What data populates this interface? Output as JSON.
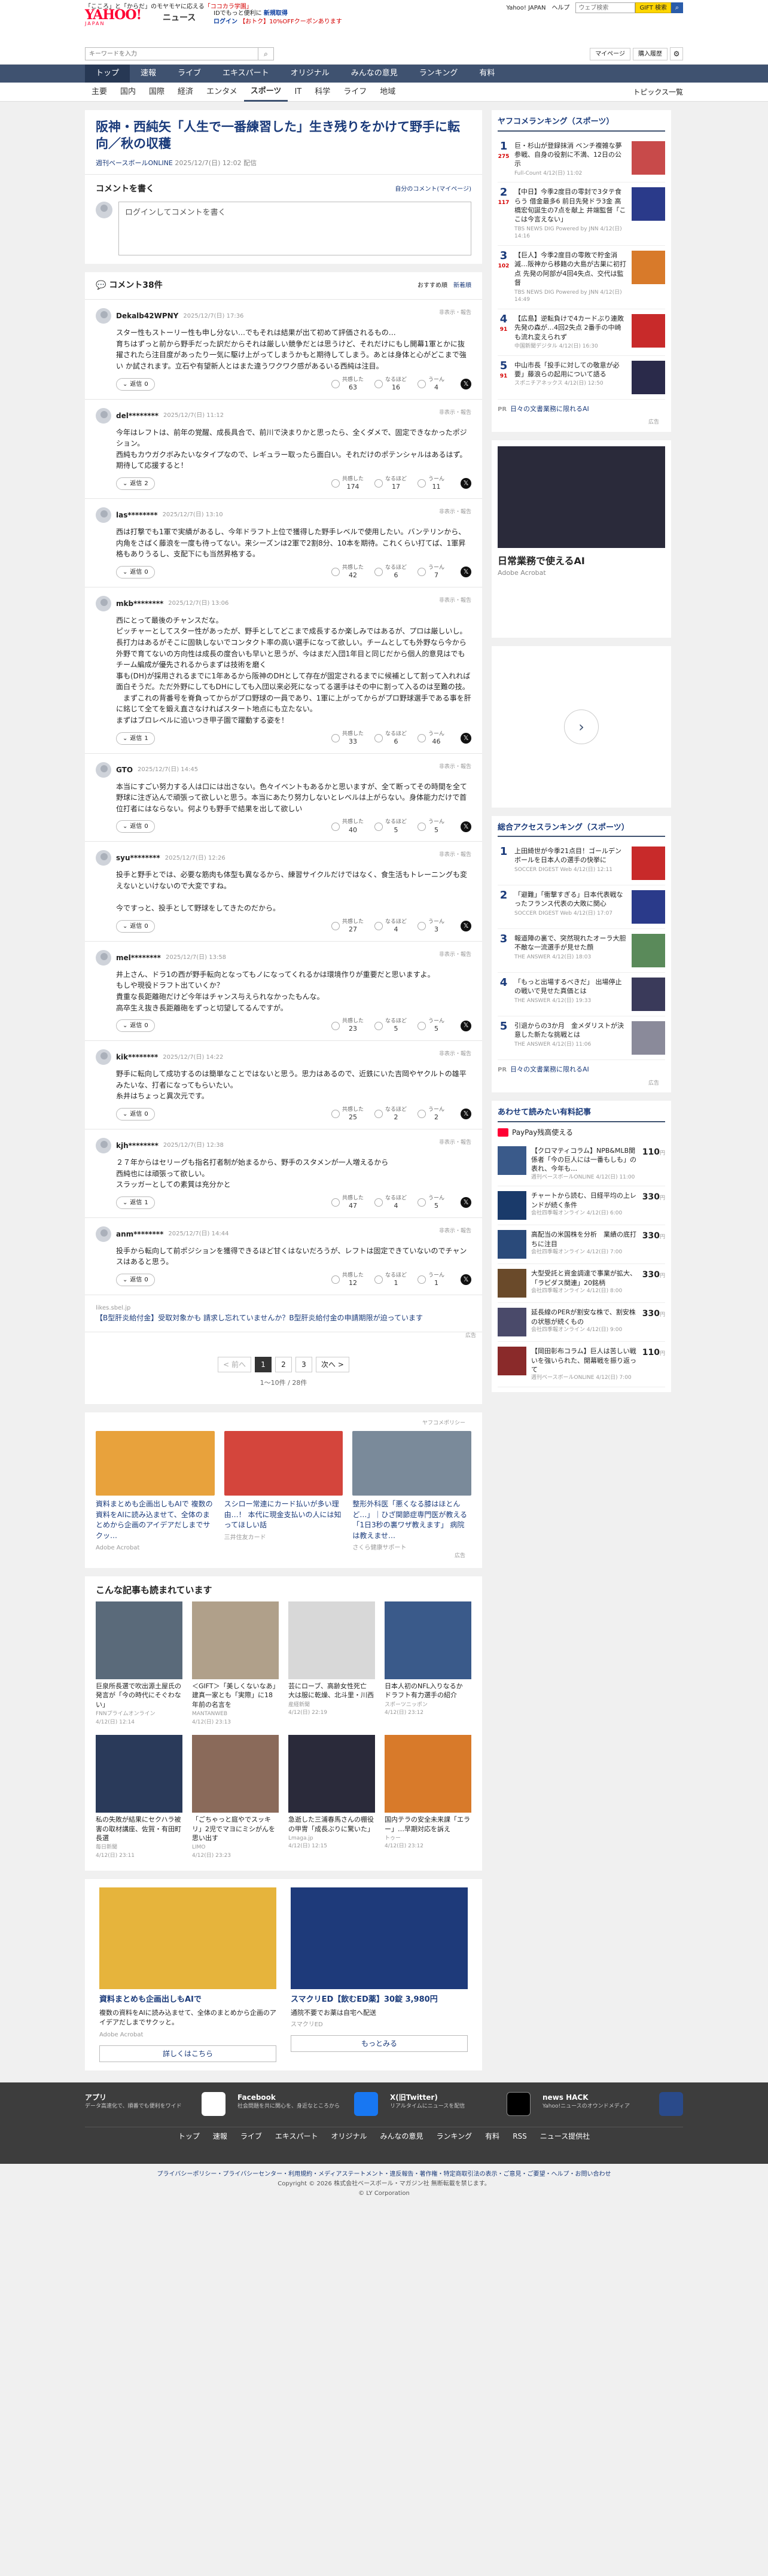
{
  "header": {
    "promo_plain": "「こころ」と「からだ」のモヤモヤに応える",
    "promo_em": "「ココカラ学園」",
    "logo": "YAHOO!",
    "logo_sub": "JAPAN",
    "service": "ニュース",
    "msg_line1": "IDでもっと便利に",
    "msg_line1_em": "新規取得",
    "msg_line2_a": "ログイン",
    "msg_line2_b": "【おトク】10%OFFクーポンあります",
    "top_links": [
      "Yahoo! JAPAN",
      "ヘルプ"
    ],
    "top_search_placeholder": "ウェブ検索",
    "top_gift": "GIFT 検索",
    "search_placeholder": "キーワードを入力",
    "links": [
      "マイページ",
      "購入履歴"
    ]
  },
  "nav": {
    "primary": [
      "トップ",
      "速報",
      "ライブ",
      "エキスパート",
      "オリジナル",
      "みんなの意見",
      "ランキング",
      "有料"
    ],
    "secondary": [
      "主要",
      "国内",
      "国際",
      "経済",
      "エンタメ",
      "スポーツ",
      "IT",
      "科学",
      "ライフ",
      "地域"
    ],
    "secondary_active": 5,
    "topics": "トピックス一覧"
  },
  "article": {
    "title": "阪神・西純矢「人生で一番練習した」生き残りをかけて野手に転向／秋の収穫",
    "source": "週刊ベースボールONLINE",
    "date": "2025/12/7(日) 12:02 配信"
  },
  "compose": {
    "heading": "コメントを書く",
    "policy": "自分のコメント(マイページ)",
    "placeholder": "ログインしてコメントを書く"
  },
  "comments_head": {
    "title": "コメント38件",
    "sort": [
      "おすすめ順",
      "新着順"
    ]
  },
  "comment_labels": {
    "report": "非表示・報告",
    "reply_prefix": "返信",
    "react": [
      "共感した",
      "なるほど",
      "うーん"
    ]
  },
  "comments": [
    {
      "user": "Dekalb42WPNY",
      "date": "2025/12/7(日) 17:36",
      "text": "スター性もストーリー性も申し分ない…でもそれは結果が出て初めて評価されるもの…\n育ちはずっと前から野手だった訳だからそれは厳しい競争だとは思うけど、それだけにもし開幕1軍とかに抜擢されたら注目度があったり一気に駆け上がってしまうかもと期待してしまう。あとは身体と心がどこまで強い か試されます。立石や有望新人とはまた違うワクワク感があるいる西純は注目。",
      "replies": "0",
      "r1": "63",
      "r2": "16",
      "r3": "4"
    },
    {
      "user": "del********",
      "date": "2025/12/7(日) 11:12",
      "text": "今年はレフトは、前年の覚醒、成長具合で、前川で決まりかと思ったら、全くダメで、固定できなかったポジション。\n西純もカウガクボみたいなタイプなので、レギュラー取ったら面白い。それだけのポテンシャルはあるはず。期待して応援すると！",
      "replies": "2",
      "r1": "174",
      "r2": "17",
      "r3": "11"
    },
    {
      "user": "las********",
      "date": "2025/12/7(日) 13:10",
      "text": "西は打撃でも1軍で実績があるし、今年ドラフト上位で獲得した野手レベルで使用したい。バンテリンから、内角をさばく藤浪を一度も待ってない。来シーズンは2軍で2割8分、10本を期待。これくらい打てば、1軍昇格もありうるし、支配下にも当然昇格する。",
      "replies": "0",
      "r1": "42",
      "r2": "6",
      "r3": "7"
    },
    {
      "user": "mkb********",
      "date": "2025/12/7(日) 13:06",
      "text": "西にとって最後のチャンスだな。\nピッチャーとしてスター性があったが、野手としてどこまで成長するか楽しみではあるが、プロは厳しいし。\n長打力はあるがそこに固執しないでコンタクト率の高い選手になって欲しい。チームとしても外野なら今から外野で育てないの方向性は成長の度合いも早いと思うが、今はまだ入団1年目と同じだから個人的意見はでもチーム編成が優先されるからまずは技術を磨く\n事も(DH)が採用されるまでに1年あるから阪神のDHとして存在が固定されるまでに候補として割って入れれば面白そうだ。ただ外野にしてもDHにしても入団以来必死になってる選手はその中に割って入るのは至難の技。\n　まずこれの背番号を脊負ってからがプロ野球の一員であり、1軍に上がってからがプロ野球選手である事を肝に銘じて全てを鍛え直さなければスタート地点にも立たない。\nまずはブロレベルに追いつき甲子園で躍動する姿を！",
      "replies": "1",
      "r1": "33",
      "r2": "6",
      "r3": "46"
    },
    {
      "user": "GTO",
      "date": "2025/12/7(日) 14:45",
      "text": "本当にすごい努力する人は口には出さない。色々イベントもあるかと思いますが、全て断ってその時間を全て野球に注ぎ込んで頑張って欲しいと思う。本当にあたり努力しないとレベルは上がらない。身体能力だけで首位打者にはならない。何よりも野手で結果を出して欲しい",
      "replies": "0",
      "r1": "40",
      "r2": "5",
      "r3": "5"
    },
    {
      "user": "syu********",
      "date": "2025/12/7(日) 12:26",
      "text": "投手と野手とでは、必要な筋肉も体型も異なるから、練習サイクルだけではなく、食生活もトレーニングも変えないといけないので大変ですね。\n\n今ですっと、投手として野球をしてきたのだから。",
      "replies": "0",
      "r1": "27",
      "r2": "4",
      "r3": "3"
    },
    {
      "user": "mel********",
      "date": "2025/12/7(日) 13:58",
      "text": "井上さん、ドラ1の西が野手転向となってもノになってくれるかは環境作りが重要だと思いますよ。\nもしや現役ドラフト出ていくか？\n貴重な長距離砲だけど今年はチャンス与えられなかったもんな。\n高卒生え抜き長距離砲をずっと切望してるんですが。",
      "replies": "0",
      "r1": "23",
      "r2": "5",
      "r3": "5"
    },
    {
      "user": "kik********",
      "date": "2025/12/7(日) 14:22",
      "text": "野手に転向して成功するのは簡単なことではないと思う。思力はあるので、近鉄にいた吉岡やヤクルトの雄平みたいな、打者になってもらいたい。\n糸井はちょっと異次元です。",
      "replies": "0",
      "r1": "25",
      "r2": "2",
      "r3": "2"
    },
    {
      "user": "kjh********",
      "date": "2025/12/7(日) 12:38",
      "text": "２７年からはセリーグも指名打者制が始まるから、野手のスタメンが一人増えるから\n西純也には頑張って欲しい。\nスラッガーとしての素質は充分かと",
      "replies": "1",
      "r1": "47",
      "r2": "4",
      "r3": "5"
    },
    {
      "user": "anm********",
      "date": "2025/12/7(日) 14:44",
      "text": "投手から転向して前ポジションを獲得できるほど甘くはないだろうが、レフトは固定できていないのでチャンスはあると思う。",
      "replies": "0",
      "r1": "12",
      "r2": "1",
      "r3": "1"
    }
  ],
  "promo_comment": {
    "label": "likes.sbel.jp",
    "text": "【B型肝炎給付金】受取対象かも 請求し忘れていませんか？B型肝炎給付金の申請期限が迫っています"
  },
  "ad_label": "広告",
  "pager": {
    "prev": "< 前へ",
    "pages": [
      "1",
      "2",
      "3"
    ],
    "next": "次へ >",
    "count": "1～10件 / 28件"
  },
  "policy_link": "ヤフコメポリシー",
  "ad_strip": [
    {
      "title": "資料まとめも企画出しもAIで 複数の資料をAIに読み込ませて、全体のまとめから企画のアイデアだしまでサクッ…",
      "sponsor": "Adobe Acrobat",
      "color": "#e8a23c"
    },
    {
      "title": "スシロー常連にカード払いが多い理由…！ 本代に現金支払いの人には知ってほしい話",
      "sponsor": "三井住友カード",
      "color": "#d4453c"
    },
    {
      "title": "整形外科医「悪くなる膝はほとんど…」｜ひざ関節症専門医が教える「1日3秒の裏ワザ教えます」 病院は教えませ…",
      "sponsor": "さくら健康サポート",
      "color": "#7a8a9a"
    }
  ],
  "recommended": {
    "heading": "こんな記事も読まれています",
    "items": [
      {
        "title": "巨泉所長選で吹出源土屋氏の発言が「今の時代にそぐわない」",
        "src": "FNNプライムオンライン",
        "date": "4/12(日) 12:14",
        "color": "#5a6a7a"
      },
      {
        "title": "＜GIFT＞「美しくないなあ」建真一家とも「実際」に18年前の名言を",
        "src": "MANTANWEB",
        "date": "4/12(日) 23:13",
        "color": "#b0a08a"
      },
      {
        "title": "芸にローブ、高齢女性死亡　大は服に乾燥、北斗里・川西",
        "src": "産経新聞",
        "date": "4/12(日) 22:19",
        "color": "#d8d8d8"
      },
      {
        "title": "日本人初のNFL入りなるか　ドラフト有力選手の紹介",
        "src": "スポーツニッポン",
        "date": "4/12(日) 23:12",
        "color": "#3a5a8a"
      },
      {
        "title": "私の失敗が結果にセクハラ被害の取材講座、佐賀・有田町長選",
        "src": "毎日新聞",
        "date": "4/12(日) 23:11",
        "color": "#2a3a5a"
      },
      {
        "title": "「ごちゃっと庭やでスッキリ」2児でマヨにミシがんを思い出す",
        "src": "LIMO",
        "date": "4/12(日) 23:23",
        "color": "#8a6a5a"
      },
      {
        "title": "急逝した三浦春馬さんの棚役の甲冑「成長ぶりに驚いた」",
        "src": "Lmaga.jp",
        "date": "4/12(日) 12:15",
        "color": "#2a2a3a"
      },
      {
        "title": "国内テラの安全未来課「エラー」…早期対応を訴え",
        "src": "トゥー",
        "date": "4/12(日) 23:12",
        "color": "#d87a2a"
      }
    ]
  },
  "bottom_ads": [
    {
      "title": "資料まとめも企画出しもAIで",
      "desc": "複数の資料をAIに読み込ませて、全体のまとめから企画のアイデアだしまでサクッと。",
      "sponsor": "Adobe Acrobat",
      "more": "詳しくはこちら",
      "color": "#e6b43c"
    },
    {
      "title": "スマクリED【飲むED薬】30錠 3,980円",
      "desc": "通院不要でお薬は自宅へ配送",
      "sponsor": "スマクリED",
      "more": "もっとみる",
      "color": "#1e3a7a"
    }
  ],
  "sidebar": {
    "ranking_heading": "ヤフコメランキング（スポーツ）",
    "ranking": [
      {
        "n": "1",
        "c": "275",
        "title": "巨・杉山が登録抹消 ベンチ複雑な夢参戦、自身の役割に不満、12日の公示",
        "src": "Full-Count",
        "date": "4/12(日) 11:02",
        "color": "#c84a4a"
      },
      {
        "n": "2",
        "c": "117",
        "title": "【中日】今季2度目の零封で3タテ食らう 借金最多6 前日先発ドラ3金 高橋宏旬誕生の7点を献上 井端監督「ここは今言えない」",
        "src": "TBS NEWS DIG Powered by JNN",
        "date": "4/12(日) 14:16",
        "color": "#2a3a8a"
      },
      {
        "n": "3",
        "c": "102",
        "title": "【巨人】今季2度目の零敗で貯金消滅…阪神から移籍の大島が古巣に初打点 先発の阿部が4回4失点、交代は監督",
        "src": "TBS NEWS DIG Powered by JNN",
        "date": "4/12(日) 14:49",
        "color": "#d87a2a"
      },
      {
        "n": "4",
        "c": "91",
        "title": "【広島】逆転負けで4カードぶり連敗 先発の森が…4回2失点 2番手の中崎も流れ変えられず",
        "src": "中国新聞デジタル",
        "date": "4/12(日) 16:30",
        "color": "#c82a2a"
      },
      {
        "n": "5",
        "c": "91",
        "title": "中山市長「投手に対しての敬意が必要」藤浪らの起用について語る",
        "src": "スポニチアネックス",
        "date": "4/12(日) 12:50",
        "color": "#2a2a4a"
      }
    ],
    "pr": "日々の文書業務に限れるAI",
    "pr_label": "PR",
    "ad_title": "日常業務で使えるAI",
    "ad_sponsor": "Adobe Acrobat",
    "access_heading": "総合アクセスランキング（スポーツ）",
    "access": [
      {
        "n": "1",
        "title": "上田綺世が今季21点目！ゴールデンボールを日本人の選手の快挙に",
        "src": "SOCCER DIGEST Web",
        "date": "4/12(日) 12:11",
        "color": "#c82a2a"
      },
      {
        "n": "2",
        "title": "「避難」「衝撃すぎる」日本代表戦なったフランス代表の大敗に関心",
        "src": "SOCCER DIGEST Web",
        "date": "4/12(日) 17:07",
        "color": "#2a3a8a"
      },
      {
        "n": "3",
        "title": "報道陣の裏で、突然現れたオーラ大胆不敵な一流選手が見せた顔",
        "src": "THE ANSWER",
        "date": "4/12(日) 18:03",
        "color": "#5a8a5a"
      },
      {
        "n": "4",
        "title": "「もっと出場するべきだ」 出場停止の戦いで見せた真価とは",
        "src": "THE ANSWER",
        "date": "4/12(日) 19:33",
        "color": "#3a3a5a"
      },
      {
        "n": "5",
        "title": "引退からの3か月　金メダリストが決意した新たな挑戦とは",
        "src": "THE ANSWER",
        "date": "4/12(日) 11:06",
        "color": "#8a8a9a"
      }
    ],
    "pay_heading": "あわせて読みたい有料記事",
    "pay_logo": "PayPay残高使える",
    "pay": [
      {
        "title": "【クロマティコラム】NPB&MLB関係者「今の巨人には一番もしも」の表れ、今年も…",
        "src": "週刊ベースボールONLINE",
        "date": "4/12(日) 11:00",
        "price": "110",
        "color": "#3a5a8a"
      },
      {
        "title": "チャートから読む、日経平均の上レンドが続く条件",
        "src": "会社四季報オンライン",
        "date": "4/12(日) 6:00",
        "price": "330",
        "color": "#1a3a6a"
      },
      {
        "title": "高配当の米国株を分析　業績の底打ちに注目",
        "src": "会社四季報オンライン",
        "date": "4/12(日) 7:00",
        "price": "330",
        "color": "#2a4a7a"
      },
      {
        "title": "大型受託と資金調達で事業が拡大、「ラピダス関連」20銘柄",
        "src": "会社四季報オンライン",
        "date": "4/12(日) 8:00",
        "price": "330",
        "color": "#6a4a2a"
      },
      {
        "title": "延長線のPERが割安な株で、割安株の状態が続くもの",
        "src": "会社四季報オンライン",
        "date": "4/12(日) 9:00",
        "price": "330",
        "color": "#4a4a6a"
      },
      {
        "title": "【岡田彰布コラム】巨人は苦しい戦いを強いられた、開幕戦を振り返って",
        "src": "週刊ベースボールONLINE",
        "date": "4/12(日) 7:00",
        "price": "110",
        "color": "#8a2a2a"
      }
    ]
  },
  "footer": {
    "cols": [
      {
        "title": "アプリ",
        "desc": "データ高速化で、順番でも便利をワイド"
      },
      {
        "title": "Facebook",
        "desc": "社会問題を共に関心を、身近なところから"
      },
      {
        "title": "X(旧Twitter)",
        "desc": "リアルタイムにニュースを配信"
      },
      {
        "title": "news HACK",
        "desc": "Yahoo!ニュースのオウンドメディア"
      }
    ],
    "nav": [
      "トップ",
      "速報",
      "ライブ",
      "エキスパート",
      "オリジナル",
      "みんなの意見",
      "ランキング",
      "有料",
      "RSS",
      "ニュース提供社"
    ],
    "legal1": "プライバシーポリシー・プライバシーセンター・利用規約・メディアステートメント・違反報告・著作権・特定商取引法の表示・ご意見・ご要望・ヘルプ・お問い合わせ",
    "legal2": "Copyright © 2026 株式会社ベースボール・マガジン社 無断転載を禁じます。",
    "legal3": "© LY Corporation"
  }
}
